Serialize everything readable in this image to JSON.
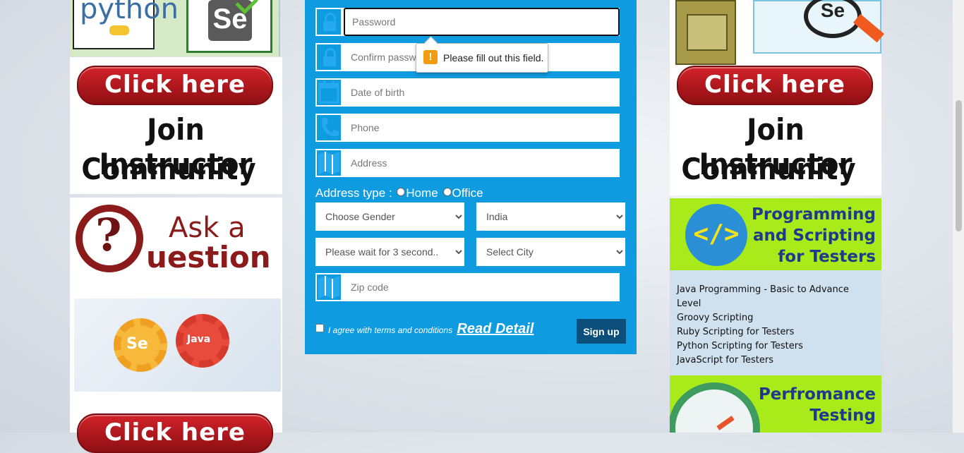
{
  "form": {
    "password_placeholder": "Password",
    "confirm_password_placeholder": "Confirm password",
    "dob_placeholder": "Date of birth",
    "phone_placeholder": "Phone",
    "address_placeholder": "Address",
    "address_type_label": "Address type :",
    "address_type_home": "Home",
    "address_type_office": "Office",
    "gender_selected": "Choose Gender",
    "country_selected": "India",
    "state_selected": "Please wait for 3 second..",
    "city_selected": "Select City",
    "zip_placeholder": "Zip code",
    "terms_text": "I agree with terms and conditions",
    "read_detail_link": "Read Detail",
    "signup_button": "Sign up",
    "validation_tooltip": "Please fill out this field.",
    "accent_color": "#0f9be0",
    "signup_color": "#0b4f7a"
  },
  "left_ads": {
    "logo_python": "python",
    "logo_selenium": "Se",
    "click_here": "Click here",
    "join_line1": "Join Instructor",
    "join_line2": "Community",
    "ask_line1": "Ask a",
    "ask_q": "?",
    "ask_line2": "uestion",
    "gear_se": "Se",
    "gear_java": "Java",
    "click_here_bottom": "Click here"
  },
  "right_ads": {
    "screen_se": "Se",
    "click_here": "Click here",
    "join_line1": "Join Instructor",
    "join_line2": "Community",
    "code_icon_text": "</>",
    "programming_title_lines": [
      "Programming",
      "and Scripting",
      "for Testers"
    ],
    "courses": [
      "Java Programming - Basic to Advance Level",
      "Groovy Scripting",
      "Ruby Scripting for Testers",
      "Python Scripting for Testers",
      "JavaScript for Testers"
    ],
    "performance_title_lines": [
      "Perfromance",
      "Testing"
    ]
  }
}
